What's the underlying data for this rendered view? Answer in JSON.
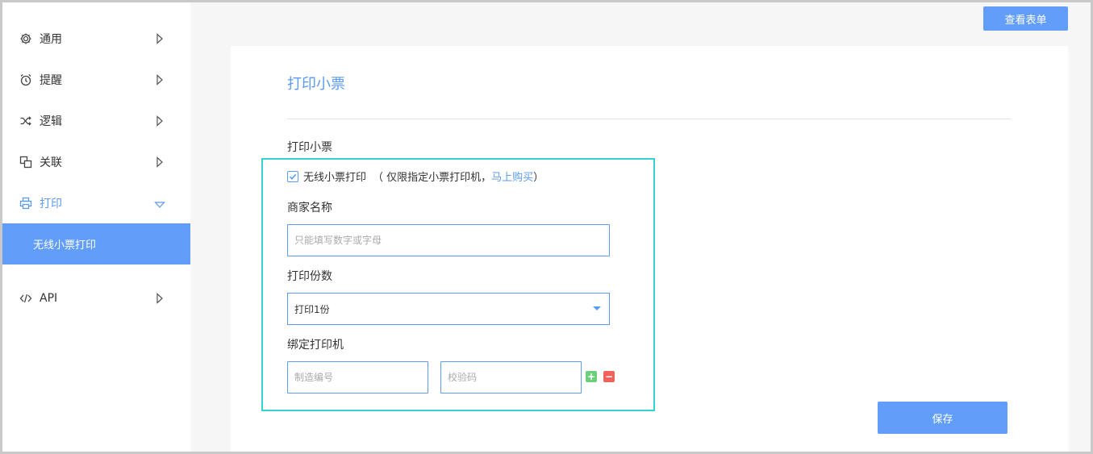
{
  "header": {
    "view_form_label": "查看表单"
  },
  "sidebar": {
    "items": [
      {
        "label": "通用",
        "icon": "gear-icon"
      },
      {
        "label": "提醒",
        "icon": "alarm-clock-icon"
      },
      {
        "label": "逻辑",
        "icon": "shuffle-icon"
      },
      {
        "label": "关联",
        "icon": "link-squares-icon"
      },
      {
        "label": "打印",
        "icon": "printer-icon"
      },
      {
        "label": "API",
        "icon": "code-icon"
      }
    ],
    "sub_item": "无线小票打印",
    "active_color": "#5b9bf0"
  },
  "panel": {
    "title": "打印小票",
    "section_label": "打印小票",
    "checkbox": {
      "checked": true,
      "label": "无线小票打印",
      "note_prefix": "（ 仅限指定小票打印机，",
      "link": "马上购买",
      "note_suffix": " ）"
    },
    "merchant_label": "商家名称",
    "merchant_placeholder": "只能填写数字或字母",
    "copies_label": "打印份数",
    "copies_value": "打印1份",
    "printer_label": "绑定打印机",
    "serial_placeholder": "制造编号",
    "code_placeholder": "校验码",
    "add_symbol": "+",
    "remove_symbol": "−",
    "save_label": "保存"
  },
  "colors": {
    "accent": "#629ef9",
    "highlight_border": "#35d3cf",
    "add_green": "#6ccf7c",
    "remove_red": "#f0625c"
  }
}
